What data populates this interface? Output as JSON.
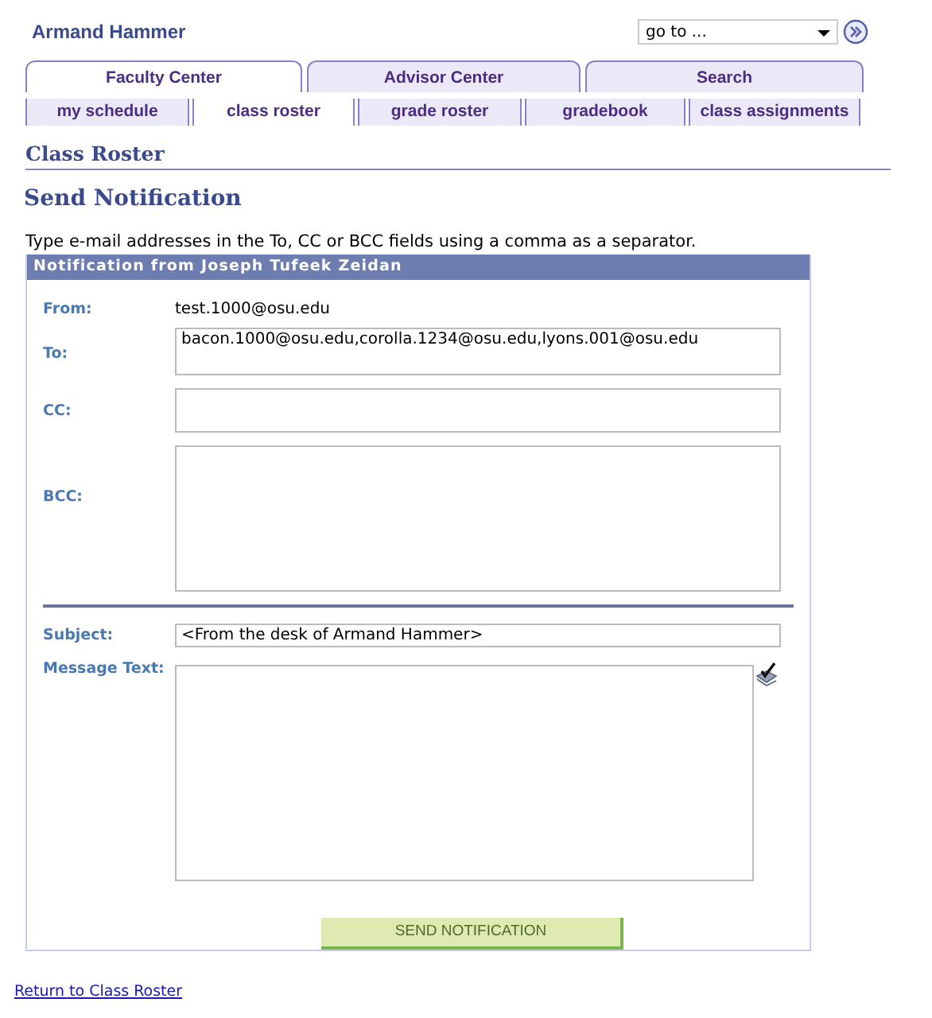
{
  "user_name": "Armand  Hammer",
  "goto": {
    "value": "go to ..."
  },
  "tabs": [
    {
      "label": "Faculty Center",
      "selected": true
    },
    {
      "label": "Advisor Center",
      "selected": false
    },
    {
      "label": "Search",
      "selected": false
    }
  ],
  "subtabs": [
    {
      "label": "my schedule",
      "selected": false
    },
    {
      "label": "class roster",
      "selected": true
    },
    {
      "label": "grade roster",
      "selected": false
    },
    {
      "label": "gradebook",
      "selected": false
    },
    {
      "label": "class assignments",
      "selected": false
    }
  ],
  "page_title": "Class Roster",
  "section_title": "Send Notification",
  "instructions": "Type e-mail addresses in the To, CC or BCC fields using a comma as a separator.",
  "panel": {
    "title": "Notification from Joseph Tufeek Zeidan",
    "from": {
      "label": "From:",
      "value": "test.1000@osu.edu"
    },
    "to": {
      "label": "To:",
      "value": "bacon.1000@osu.edu,corolla.1234@osu.edu,lyons.001@osu.edu"
    },
    "cc": {
      "label": "CC:"
    },
    "bcc": {
      "label": "BCC:"
    },
    "subject": {
      "label": "Subject:",
      "value": "<From the desk of Armand Hammer>"
    },
    "message": {
      "label": "Message Text:"
    },
    "button": "SEND NOTIFICATION"
  },
  "return_link": "Return to Class Roster"
}
